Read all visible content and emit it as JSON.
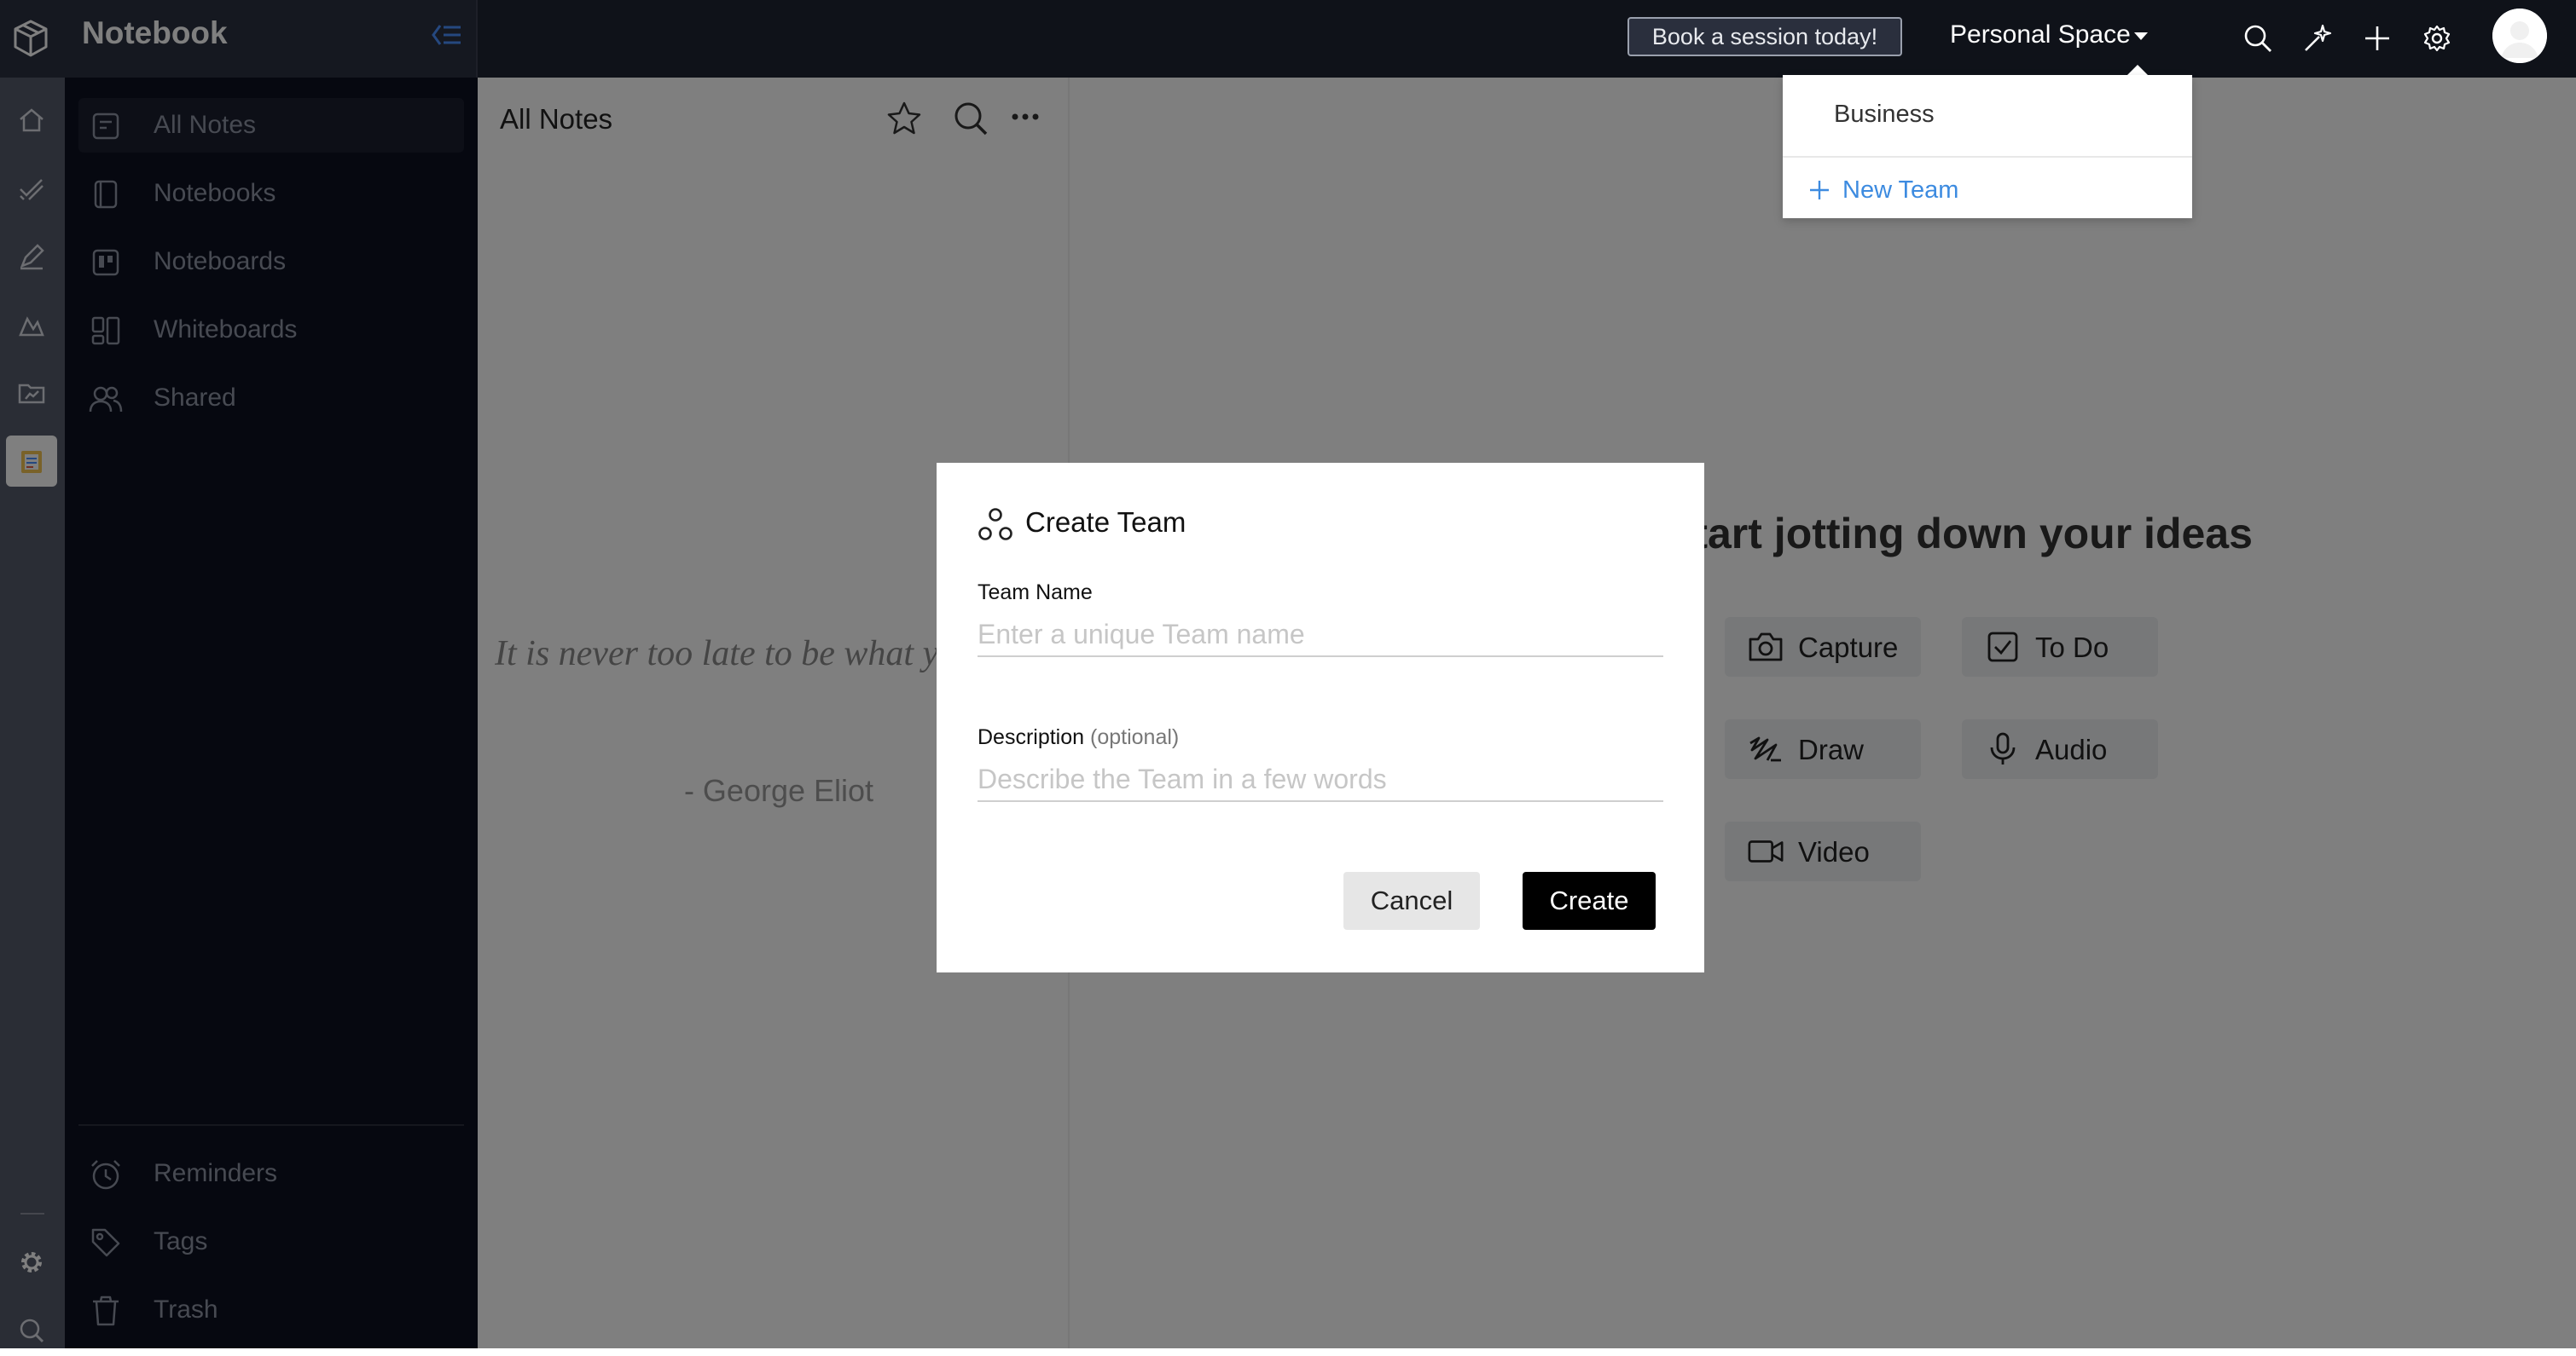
{
  "header": {
    "app_title": "Notebook",
    "book_session": "Book a session today!",
    "space_selector": "Personal Space"
  },
  "sidebar": {
    "items": [
      {
        "label": "All Notes",
        "icon": "note-icon",
        "active": true
      },
      {
        "label": "Notebooks",
        "icon": "notebook-icon"
      },
      {
        "label": "Noteboards",
        "icon": "noteboard-icon"
      },
      {
        "label": "Whiteboards",
        "icon": "whiteboard-icon"
      },
      {
        "label": "Shared",
        "icon": "people-icon"
      }
    ],
    "bottom_items": [
      {
        "label": "Reminders",
        "icon": "alarm-icon"
      },
      {
        "label": "Tags",
        "icon": "tag-icon"
      },
      {
        "label": "Trash",
        "icon": "trash-icon"
      }
    ]
  },
  "notes_list": {
    "title": "All Notes",
    "quote": "It is never too late to be what you might have been.",
    "quote_author": "- George Eliot"
  },
  "empty_state": {
    "heading": "Start jotting down your ideas",
    "actions": [
      {
        "label": "Capture",
        "icon": "camera-icon"
      },
      {
        "label": "To Do",
        "icon": "checkbox-icon"
      },
      {
        "label": "Draw",
        "icon": "draw-icon"
      },
      {
        "label": "Audio",
        "icon": "microphone-icon"
      },
      {
        "label": "Video",
        "icon": "video-icon"
      }
    ]
  },
  "space_dropdown": {
    "items": [
      "Business"
    ],
    "new_team": "New Team"
  },
  "modal": {
    "title": "Create Team",
    "team_name_label": "Team Name",
    "team_name_placeholder": "Enter a unique Team name",
    "description_label": "Description",
    "description_optional": "(optional)",
    "description_placeholder": "Describe the Team in a few words",
    "cancel": "Cancel",
    "create": "Create"
  },
  "colors": {
    "topbar": "#1f2433",
    "sidebar": "#0c1020",
    "rail": "#555b6b",
    "accent_blue": "#3d8be0",
    "primary_button": "#000000"
  }
}
